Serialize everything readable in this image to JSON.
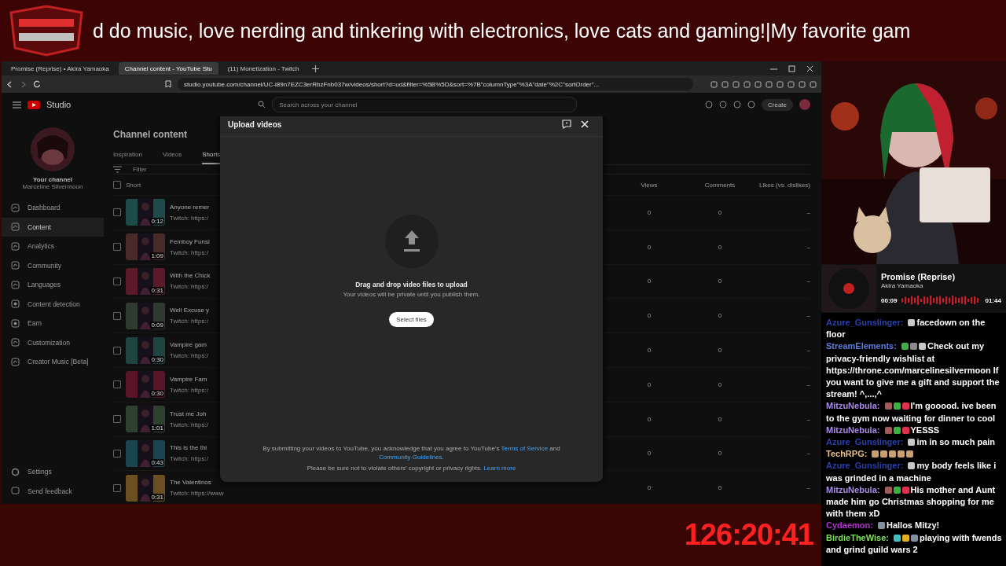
{
  "banner": {
    "marquee": "d do music, love nerding and tinkering with electronics, love cats and gaming!|My favorite gam"
  },
  "browser": {
    "tabs": [
      {
        "label": "Promise (Reprise) • Akira Yamaoka",
        "selected": false
      },
      {
        "label": "Channel content - YouTube Stu",
        "selected": true
      },
      {
        "label": "(11) Monetization - Twitch",
        "selected": false
      }
    ],
    "url": "studio.youtube.com/channel/UC-i89n7EZC3erRbzFnb037w/videos/short?d=ud&filter=%5B%5D&sort=%7B\"columnType\"%3A\"date\"%2C\"sortOrder\"..."
  },
  "studio": {
    "logo": "Studio",
    "search": {
      "placeholder": "Search across your channel"
    },
    "create_button": "Create",
    "sidebar": {
      "channel_label": "Your channel",
      "channel_name": "Marceline Silvermoon",
      "items": [
        {
          "label": "Dashboard",
          "selected": false
        },
        {
          "label": "Content",
          "selected": true
        },
        {
          "label": "Analytics",
          "selected": false
        },
        {
          "label": "Community",
          "selected": false
        },
        {
          "label": "Languages",
          "selected": false
        },
        {
          "label": "Content detection",
          "selected": false
        },
        {
          "label": "Earn",
          "selected": false
        },
        {
          "label": "Customization",
          "selected": false
        },
        {
          "label": "Creator Music [Beta]",
          "selected": false
        }
      ],
      "footer_items": [
        "Settings",
        "Send feedback"
      ]
    },
    "page_title": "Channel content",
    "tabs": [
      {
        "label": "Inspiration",
        "selected": false
      },
      {
        "label": "Videos",
        "selected": false
      },
      {
        "label": "Shorts",
        "selected": true
      }
    ],
    "filter": {
      "placeholder": "Filter"
    },
    "table": {
      "columns": [
        "Short",
        "Views",
        "Comments",
        "Likes (vs. dislikes)"
      ],
      "select_all": {
        "checked": false
      },
      "rows": [
        {
          "checked": false,
          "title": "Anyone remer",
          "description": "Twitch: https:/",
          "duration": "0:12",
          "views": "0",
          "comments": "0",
          "likes": "–"
        },
        {
          "checked": false,
          "title": "Femboy Funsi",
          "description": "Twitch: https:/",
          "duration": "1:09",
          "views": "0",
          "comments": "0",
          "likes": "–"
        },
        {
          "checked": false,
          "title": "With the Chick",
          "description": "Twitch: https:/",
          "duration": "0:31",
          "views": "0",
          "comments": "0",
          "likes": "–"
        },
        {
          "checked": false,
          "title": "Well Excuse y",
          "description": "Twitch: https:/",
          "duration": "0:09",
          "views": "0",
          "comments": "0",
          "likes": "–"
        },
        {
          "checked": false,
          "title": "Vampire gam",
          "description": "Twitch: https:/",
          "duration": "0:30",
          "views": "0",
          "comments": "0",
          "likes": "–"
        },
        {
          "checked": false,
          "title": "Vampire Fam",
          "description": "Twitch: https:/",
          "duration": "0:30",
          "views": "0",
          "comments": "0",
          "likes": "–"
        },
        {
          "checked": false,
          "title": "Trust me Joh",
          "description": "Twitch: https:/",
          "duration": "1:01",
          "views": "0",
          "comments": "0",
          "likes": "–"
        },
        {
          "checked": false,
          "title": "This is the thi",
          "description": "Twitch: https:/",
          "duration": "0:43",
          "views": "0",
          "comments": "0",
          "likes": "–"
        },
        {
          "checked": false,
          "title": "The Valentinos",
          "description": "Twitch: https://www",
          "duration": "0:31",
          "views": "0",
          "comments": "0",
          "likes": "–"
        }
      ]
    }
  },
  "dialog": {
    "title": "Upload videos",
    "heading": "Drag and drop video files to upload",
    "subtext": "Your videos will be private until you publish them.",
    "button": "Select files",
    "terms": {
      "before": "By submitting your videos to YouTube, you acknowledge that you agree to YouTube's",
      "link1": "Terms of Service",
      "middle": "and",
      "link2": "Community Guidelines.",
      "line2": "Please be sure not to violate others' copyright or privacy rights.",
      "link3": "Learn more"
    }
  },
  "timer": "126:20:41",
  "player": {
    "title": "Promise (Reprise)",
    "artist": "Akira Yamaoka",
    "elapsed": "00:09",
    "total": "01:44"
  },
  "chat": [
    {
      "user": "Azure_Gunslinger:",
      "color": "#2a3fb0",
      "emotes": [
        {
          "kind": "box"
        }
      ],
      "text": "facedown on the floor"
    },
    {
      "user": "StreamElements:",
      "color": "#5b7de0",
      "emotes": [
        {
          "kind": "verified"
        },
        {
          "kind": "bot"
        },
        {
          "kind": "box"
        }
      ],
      "text": "Check out my privacy-friendly wishlist at https://throne.com/marcelinesilvermoon If you want to give me a gift and support the stream! ^,...,^"
    },
    {
      "user": "MitzuNebula:",
      "color": "#a98be8",
      "emotes": [
        {
          "kind": "totem"
        },
        {
          "kind": "verified"
        },
        {
          "kind": "heart"
        }
      ],
      "text": "I'm gooood. ive been to the gym now waiting for dinner to cool"
    },
    {
      "user": "MitzuNebula:",
      "color": "#a98be8",
      "emotes": [
        {
          "kind": "totem"
        },
        {
          "kind": "verified"
        },
        {
          "kind": "heart"
        }
      ],
      "text": "YESSS"
    },
    {
      "user": "Azure_Gunslinger:",
      "color": "#2a3fb0",
      "emotes": [
        {
          "kind": "box"
        }
      ],
      "text": "im in so much pain"
    },
    {
      "user": "TechRPG:",
      "color": "#e8c08a",
      "emotes": [
        {
          "kind": "cat"
        },
        {
          "kind": "cat"
        },
        {
          "kind": "cat"
        },
        {
          "kind": "cat"
        },
        {
          "kind": "cat"
        }
      ]
    },
    {
      "user": "Azure_Gunslinger:",
      "color": "#2a3fb0",
      "emotes": [
        {
          "kind": "box"
        }
      ],
      "text": "my body feels like i was grinded in a machine"
    },
    {
      "user": "MitzuNebula:",
      "color": "#a98be8",
      "emotes": [
        {
          "kind": "totem"
        },
        {
          "kind": "verified"
        },
        {
          "kind": "heart"
        }
      ],
      "text": "His mother and Aunt made him go Christmas shopping for me with them xD"
    },
    {
      "user": "Cydaemon:",
      "color": "#b030d0",
      "emotes": [
        {
          "kind": "sword"
        }
      ],
      "text": "Hallos Mitzy!"
    },
    {
      "user": "BirdieTheWise:",
      "color": "#7ee05a",
      "emotes": [
        {
          "kind": "sub"
        },
        {
          "kind": "crown"
        },
        {
          "kind": "sword"
        }
      ],
      "text": "playing with fwends and grind guild wars 2"
    }
  ]
}
